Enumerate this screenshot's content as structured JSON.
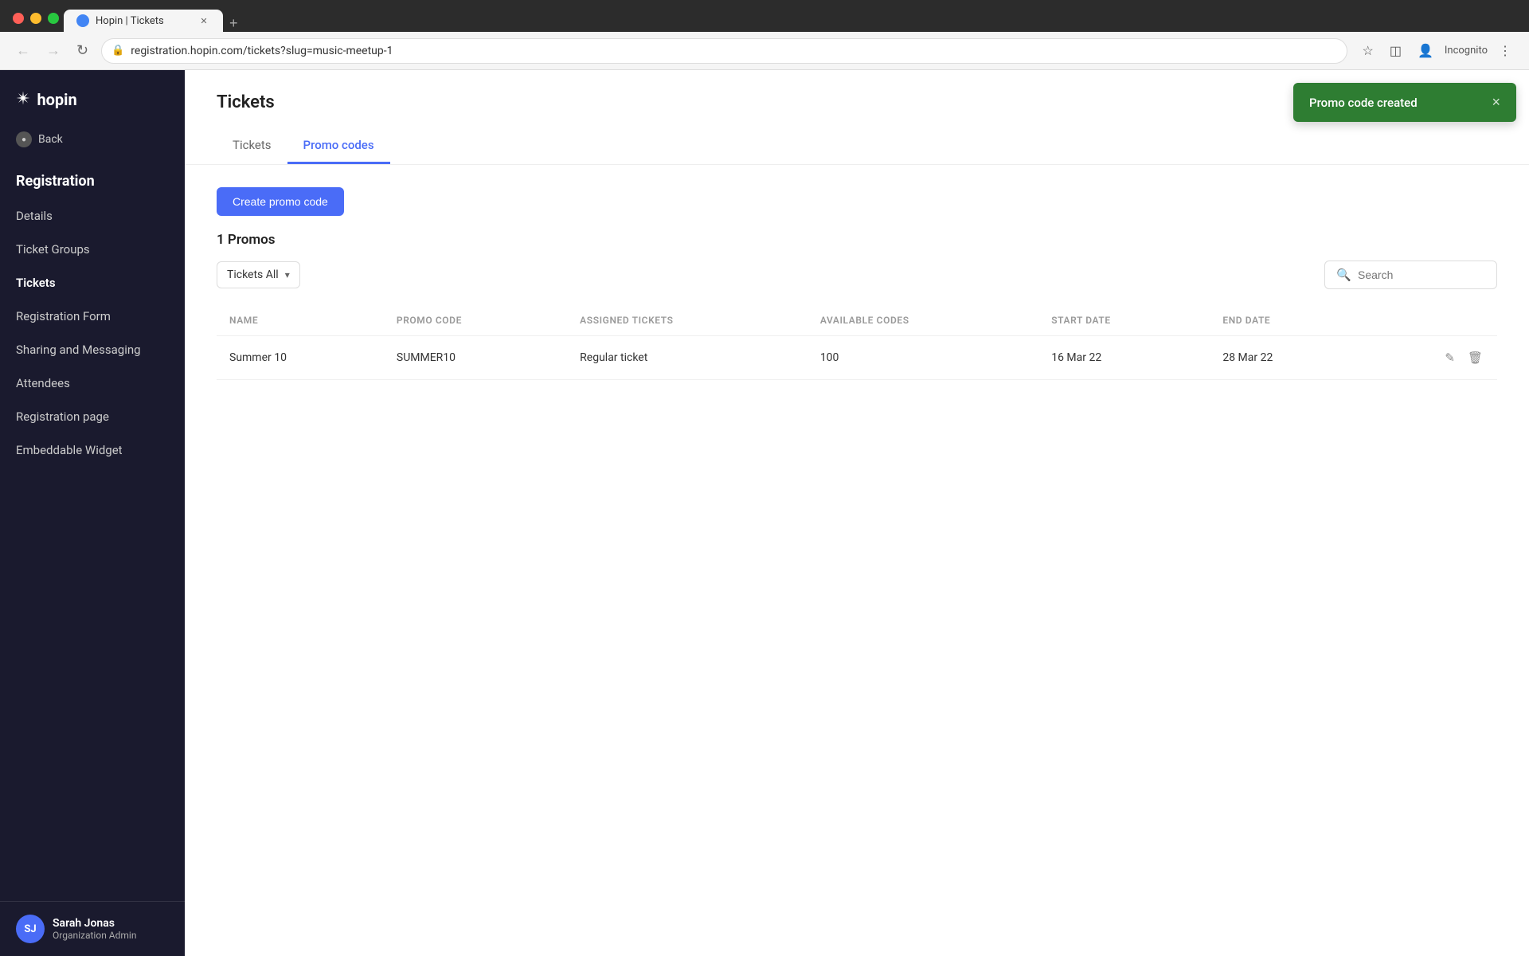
{
  "browser": {
    "tab_title": "Hopin | Tickets",
    "tab_favicon": "H",
    "address": "registration.hopin.com/tickets?slug=music-meetup-1",
    "incognito_label": "Incognito"
  },
  "page": {
    "title": "Tickets",
    "tabs": [
      {
        "id": "tickets",
        "label": "Tickets"
      },
      {
        "id": "promo_codes",
        "label": "Promo codes"
      }
    ],
    "active_tab": "promo_codes"
  },
  "toast": {
    "message": "Promo code created",
    "close_label": "×"
  },
  "content": {
    "create_button_label": "Create promo code",
    "promos_count_label": "1 Promos",
    "filter": {
      "label": "Tickets All"
    },
    "search_placeholder": "Search",
    "table": {
      "columns": [
        {
          "id": "name",
          "label": "NAME"
        },
        {
          "id": "promo_code",
          "label": "PROMO CODE"
        },
        {
          "id": "assigned_tickets",
          "label": "ASSIGNED TICKETS"
        },
        {
          "id": "available_codes",
          "label": "AVAILABLE CODES"
        },
        {
          "id": "start_date",
          "label": "START DATE"
        },
        {
          "id": "end_date",
          "label": "END DATE"
        }
      ],
      "rows": [
        {
          "name": "Summer 10",
          "promo_code": "SUMMER10",
          "assigned_tickets": "Regular ticket",
          "available_codes": "100",
          "start_date": "16 Mar 22",
          "end_date": "28 Mar 22"
        }
      ]
    }
  },
  "sidebar": {
    "logo_text": "hopin",
    "back_label": "Back",
    "section_title": "Registration",
    "nav_items": [
      {
        "id": "details",
        "label": "Details"
      },
      {
        "id": "ticket_groups",
        "label": "Ticket Groups"
      },
      {
        "id": "tickets",
        "label": "Tickets"
      },
      {
        "id": "registration_form",
        "label": "Registration Form"
      },
      {
        "id": "sharing_messaging",
        "label": "Sharing and Messaging"
      },
      {
        "id": "attendees",
        "label": "Attendees"
      },
      {
        "id": "registration_page",
        "label": "Registration page"
      },
      {
        "id": "embeddable_widget",
        "label": "Embeddable Widget"
      }
    ],
    "footer": {
      "initials": "SJ",
      "name": "Sarah Jonas",
      "role": "Organization Admin"
    }
  }
}
